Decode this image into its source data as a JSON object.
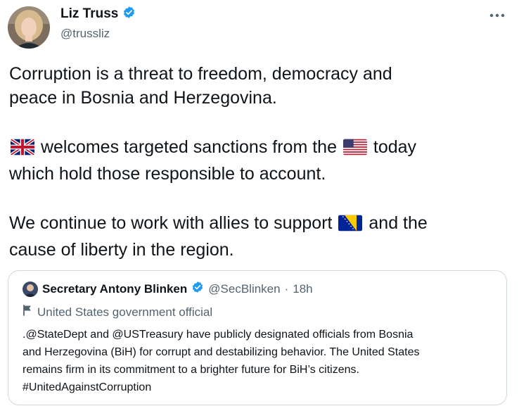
{
  "author": {
    "display_name": "Liz Truss",
    "handle": "@trussliz",
    "verified_icon": "verified-badge-icon",
    "more_icon": "more-horizontal-icon"
  },
  "tweet": {
    "paragraph1": [
      "Corruption is a threat to freedom, democracy and",
      "peace in Bosnia and Herzegovina."
    ],
    "paragraph2": {
      "line1_flag1": "uk-flag-emoji",
      "line1_text1": " welcomes targeted sanctions from the ",
      "line1_flag2": "us-flag-emoji",
      "line1_text2": " today",
      "line2": "which hold those responsible to account."
    },
    "paragraph3": {
      "line1_text1": "We continue to work with allies to support ",
      "line1_flag": "bosnia-flag-emoji",
      "line1_text2": " and the",
      "line2": "cause of liberty in the region."
    }
  },
  "quoted_tweet": {
    "display_name": "Secretary Antony Blinken",
    "handle": "@SecBlinken",
    "separator": "·",
    "time": "18h",
    "label": "United States government official",
    "label_icon": "flag-icon",
    "body": [
      ".@StateDept and @USTreasury have publicly designated officials from Bosnia",
      "and Herzegovina (BiH) for corrupt and destabilizing behavior. The United States",
      "remains firm in its commitment to a brighter future for BiH’s citizens.",
      "#UnitedAgainstCorruption"
    ]
  },
  "colors": {
    "text_primary": "#0f1419",
    "text_secondary": "#536471",
    "verified_blue": "#1d9bf0",
    "border": "#cfd9de"
  }
}
